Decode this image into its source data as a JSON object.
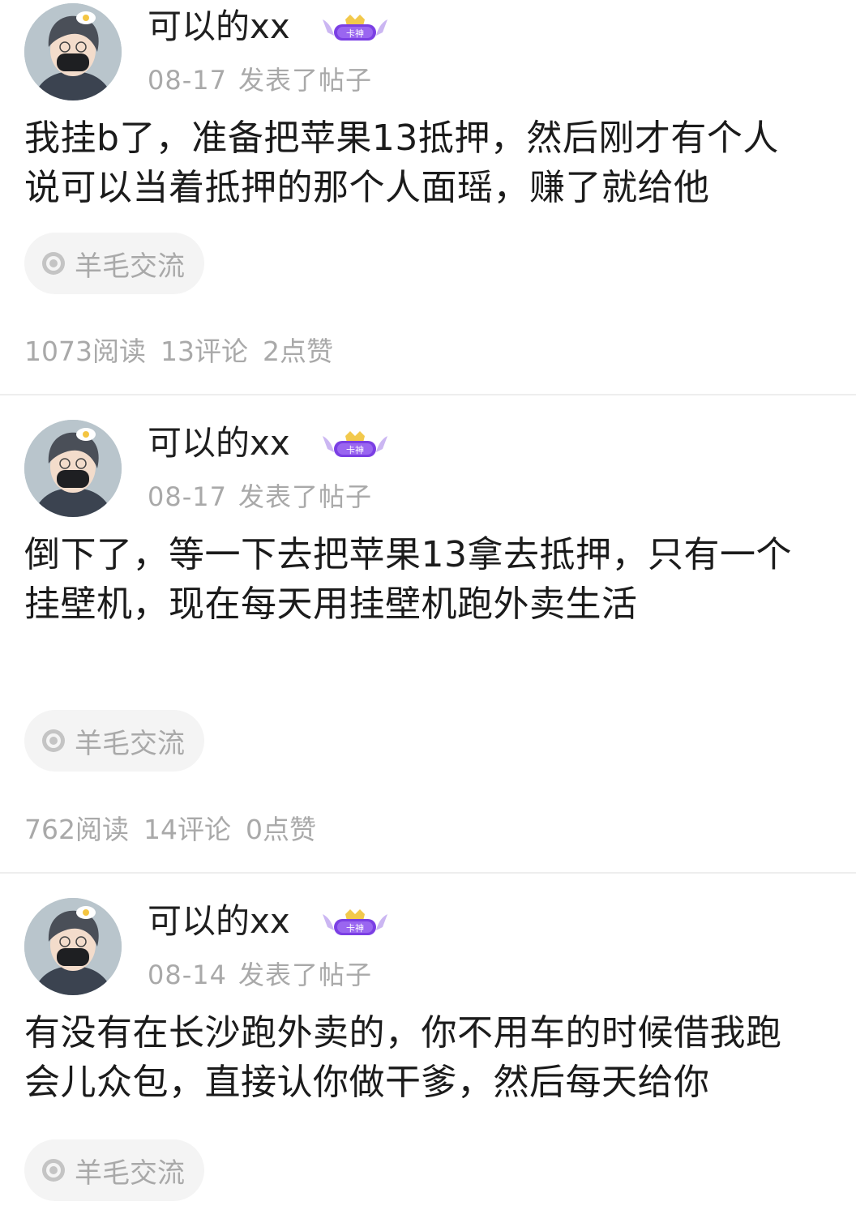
{
  "posts": [
    {
      "username": "可以的xx",
      "badge_text": "卡神",
      "date": "08-17",
      "action": "发表了帖子",
      "content_lines": [
        "我挂b了，准备把苹果13抵押，然后刚才有个人",
        "说可以当着抵押的那个人面瑶，赚了就给他"
      ],
      "tag": "羊毛交流",
      "stats": {
        "reads": "1073阅读",
        "comments": "13评论",
        "likes": "2点赞"
      }
    },
    {
      "username": "可以的xx",
      "badge_text": "卡神",
      "date": "08-17",
      "action": "发表了帖子",
      "content_lines": [
        "倒下了，等一下去把苹果13拿去抵押，只有一个",
        "挂壁机，现在每天用挂壁机跑外卖生活"
      ],
      "tag": "羊毛交流",
      "stats": {
        "reads": "762阅读",
        "comments": "14评论",
        "likes": "0点赞"
      }
    },
    {
      "username": "可以的xx",
      "badge_text": "卡神",
      "date": "08-14",
      "action": "发表了帖子",
      "content_lines": [
        "有没有在长沙跑外卖的，你不用车的时候借我跑",
        "会儿众包，直接认你做干爹，然后每天给你"
      ],
      "tag": "羊毛交流"
    }
  ],
  "icons": {
    "tag_icon": "target-circle-icon",
    "badge_icon": "winged-crown-badge-icon"
  },
  "colors": {
    "text_primary": "#1b1b1b",
    "text_secondary": "#a9a9a9",
    "tag_bg": "#f4f4f4",
    "separator": "#eeeeee",
    "badge_purple": "#7b3fe4"
  }
}
